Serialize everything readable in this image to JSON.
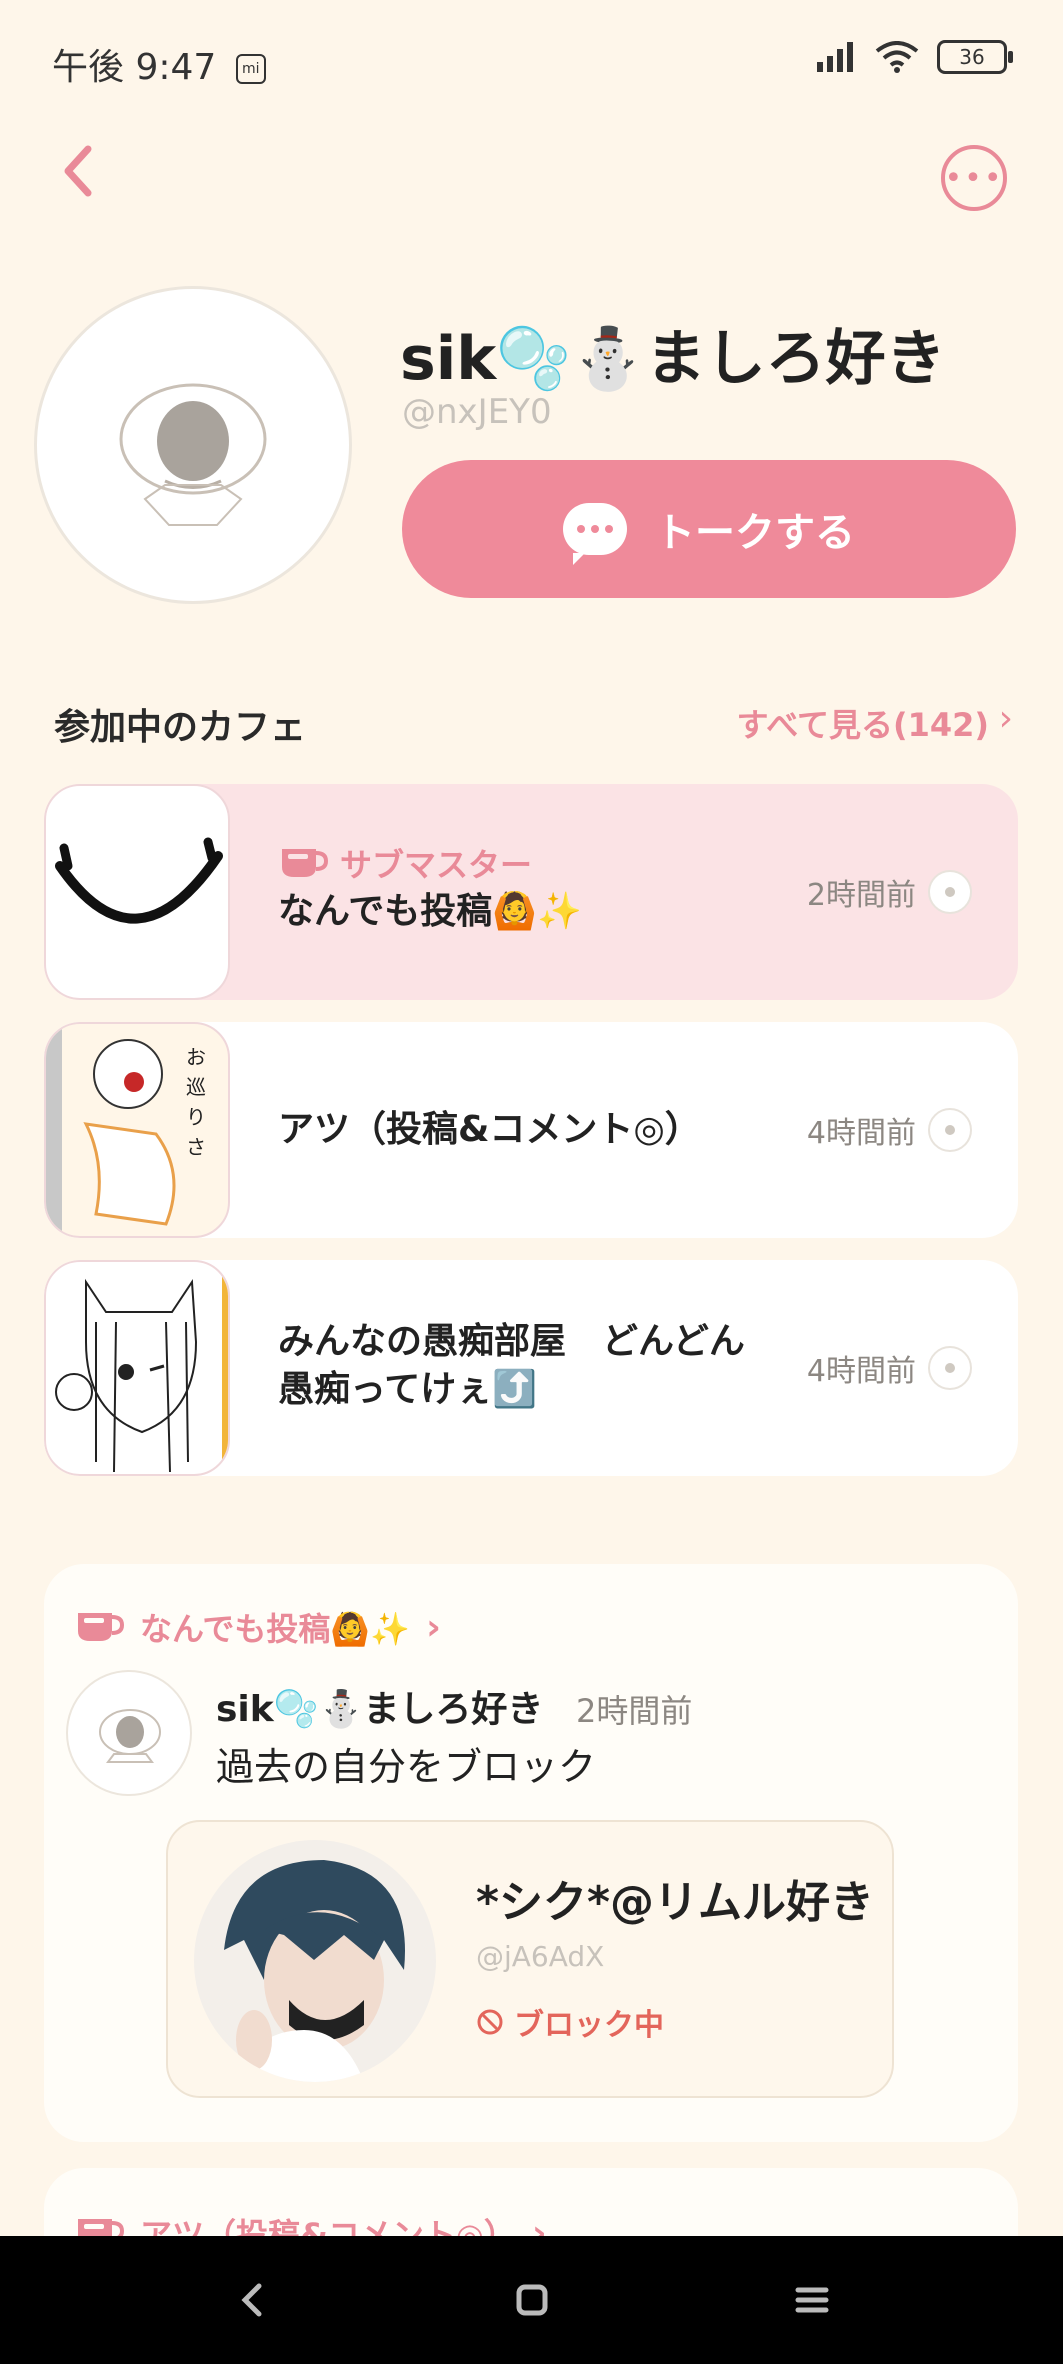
{
  "status_bar": {
    "time": "午後 9:47",
    "battery": "36"
  },
  "header": {
    "back_icon": "chevron-left-icon",
    "more_icon": "more-horizontal-icon"
  },
  "profile": {
    "name": "sik🫧⛄ましろ好き",
    "handle": "@nxJEY0",
    "talk_label": "トークする"
  },
  "cafes_section": {
    "title": "参加中のカフェ",
    "see_all": "すべて見る(142)",
    "items": [
      {
        "role": "サブマスター",
        "name": "なんでも投稿🙆✨",
        "time": "2時間前"
      },
      {
        "role": "",
        "name": "アツ（投稿&コメント◎）",
        "time": "4時間前"
      },
      {
        "role": "",
        "name": "みんなの愚痴部屋　どんどん愚痴ってけぇ⤴️",
        "time": "4時間前"
      }
    ]
  },
  "post": {
    "cafe": "なんでも投稿🙆✨",
    "author": "sik🫧⛄ましろ好き",
    "time": "2時間前",
    "text": "過去の自分をブロック",
    "embed": {
      "name": "*シク*@リムル好き",
      "handle": "@jA6AdX",
      "blocked_label": "ブロック中"
    }
  },
  "next_post": {
    "cafe": "アツ（投稿&コメント◎）"
  },
  "colors": {
    "background": "#FEF6EA",
    "accent": "#EF8A9A",
    "highlight": "#FBE3E5",
    "blocked": "#E3655B"
  }
}
